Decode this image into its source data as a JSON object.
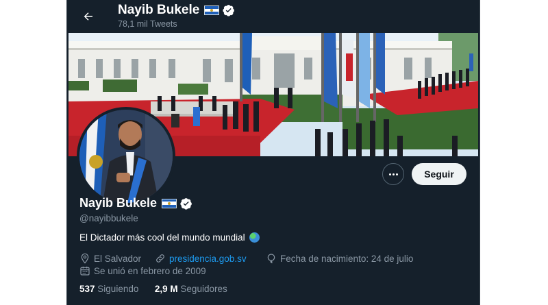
{
  "header": {
    "name": "Nayib Bukele",
    "tweet_count": "78,1 mil Tweets"
  },
  "profile": {
    "name": "Nayib Bukele",
    "handle": "@nayibbukele",
    "bio": "El Dictador más cool del mundo mundial",
    "location": "El Salvador",
    "website": "presidencia.gob.sv",
    "birthday": "Fecha de nacimiento: 24 de julio",
    "joined": "Se unió en febrero de 2009"
  },
  "actions": {
    "follow_label": "Seguir"
  },
  "stats": {
    "following_count": "537",
    "following_label": "Siguiendo",
    "followers_count": "2,9 M",
    "followers_label": "Seguidores"
  },
  "icons": {
    "back": "arrow-left-icon",
    "verified": "verified-badge-icon",
    "flag": "el-salvador-flag-icon",
    "globe": "globe-emoji-icon",
    "location": "location-pin-icon",
    "link": "link-icon",
    "birthday": "balloon-icon",
    "calendar": "calendar-icon",
    "more": "more-dots-icon"
  },
  "colors": {
    "background": "#15202b",
    "text_primary": "#ffffff",
    "text_secondary": "#8b98a5",
    "link": "#1d9bf0",
    "verified": "#ffffff",
    "follow_button_bg": "#eff3f4"
  }
}
